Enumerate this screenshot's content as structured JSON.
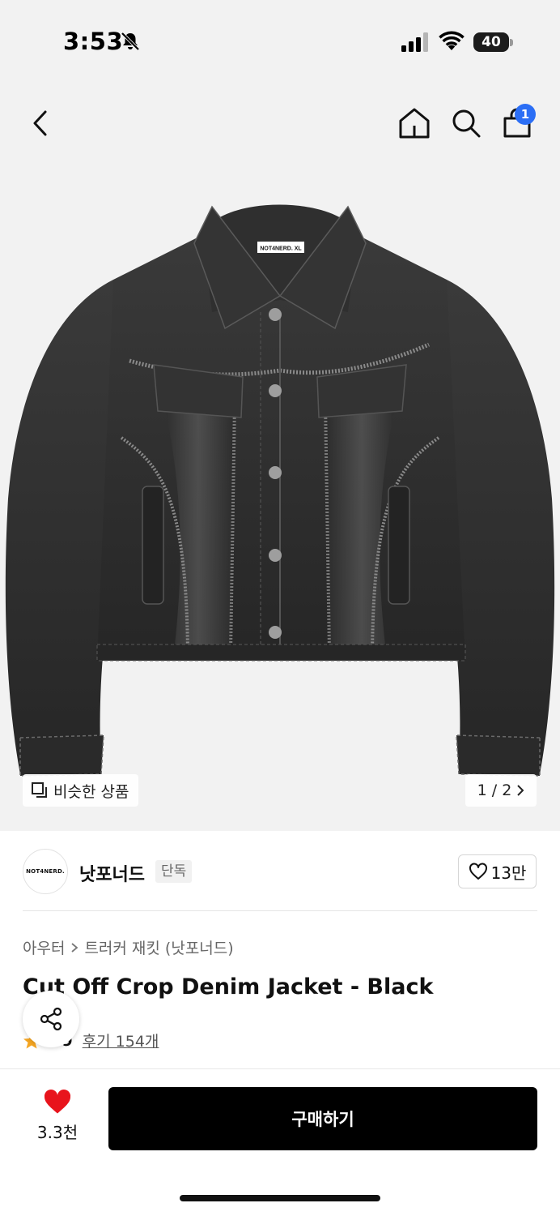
{
  "status_bar": {
    "time": "3:53",
    "battery": "40"
  },
  "nav": {
    "cart_badge": "1"
  },
  "gallery": {
    "similar_label": "비슷한 상품",
    "page_counter": "1 / 2",
    "jacket_tag_text": "NOT4NERD.  XL"
  },
  "brand": {
    "logo_text": "NOT4NERD.",
    "name": "낫포너드",
    "badge": "단독",
    "likes": "13만"
  },
  "product": {
    "breadcrumb": [
      "아우터",
      "트러커 재킷 (낫포너드)"
    ],
    "title": "Cut Off Crop Denim Jacket - Black",
    "rating": "4.9",
    "review_label": "후기 154개"
  },
  "bottom_bar": {
    "wish_count": "3.3천",
    "buy_label": "구매하기"
  },
  "colors": {
    "accent_blue": "#2b6ef5",
    "heart_red": "#e8141c",
    "star_yellow": "#f5a623",
    "buy_button": "#000000"
  },
  "icons": [
    "bell-off-icon",
    "signal-icon",
    "wifi-icon",
    "battery-icon",
    "back-icon",
    "home-icon",
    "search-icon",
    "shopping-bag-icon",
    "similar-items-icon",
    "chevron-right-icon",
    "heart-outline-icon",
    "share-icon",
    "star-icon",
    "heart-filled-icon"
  ]
}
